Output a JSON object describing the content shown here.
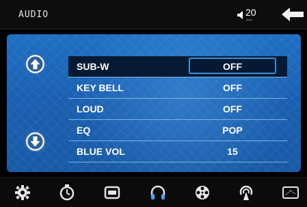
{
  "header": {
    "title": "AUDIO",
    "volume_level": "20",
    "volume_icon": "speaker-icon",
    "back_icon": "back-arrow-icon"
  },
  "menu": {
    "items": [
      {
        "label": "SUB-W",
        "value": "OFF",
        "selected": true
      },
      {
        "label": "KEY BELL",
        "value": "OFF",
        "selected": false
      },
      {
        "label": "LOUD",
        "value": "OFF",
        "selected": false
      },
      {
        "label": "EQ",
        "value": "POP",
        "selected": false
      },
      {
        "label": "BLUE VOL",
        "value": "15",
        "selected": false
      }
    ]
  },
  "bottom_nav": [
    {
      "name": "settings-gear-icon"
    },
    {
      "name": "timer-icon"
    },
    {
      "name": "display-icon"
    },
    {
      "name": "audio-headphones-icon"
    },
    {
      "name": "video-reel-icon"
    },
    {
      "name": "radio-broadcast-icon"
    },
    {
      "name": "screen-calibrate-icon"
    }
  ],
  "colors": {
    "panel_blue": "#1a5fb0",
    "selected_row": "#071a33",
    "highlight_border": "#3e8ddc",
    "bars_bg": "#0d0d0d",
    "active_icon": "#4fa3ff"
  }
}
